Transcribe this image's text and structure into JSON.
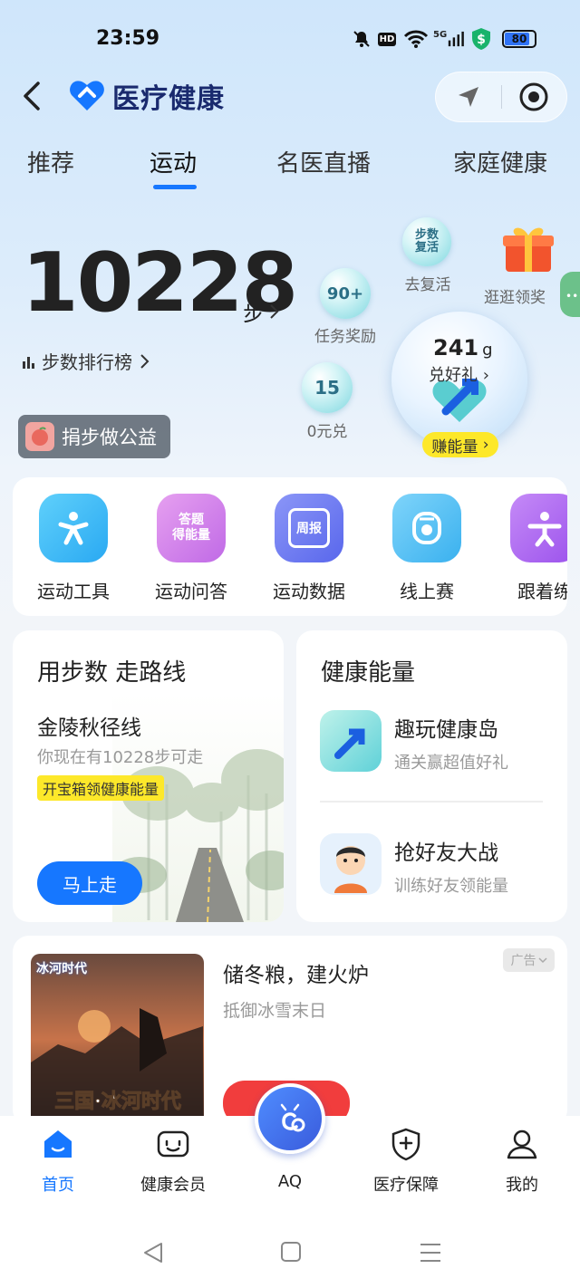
{
  "status_bar": {
    "time": "23:59",
    "hd_label": "HD",
    "network_label": "5G",
    "battery": "80"
  },
  "header": {
    "logo_text": "医疗健康",
    "icons": [
      "back-arrow-icon",
      "location-arrow-icon",
      "target-record-icon"
    ]
  },
  "tabs": [
    {
      "label": "推荐",
      "active": false
    },
    {
      "label": "运动",
      "active": true
    },
    {
      "label": "名医直播",
      "active": false
    },
    {
      "label": "家庭健康",
      "active": false
    }
  ],
  "steps": {
    "count": "10228",
    "unit": "步",
    "rank_label": "步数排行榜",
    "donate_label": "捐步做公益"
  },
  "bubbles": {
    "revive": {
      "text": "步数\n复活",
      "label": "去复活"
    },
    "gift": {
      "label": "逛逛领奖"
    },
    "task": {
      "value": "90+",
      "label": "任务奖励"
    },
    "redeem": {
      "value": "15",
      "label": "0元兑"
    }
  },
  "energy_orb": {
    "value": "241",
    "unit": "g",
    "sub": "兑好礼",
    "earn_label": "赚能量"
  },
  "tools": [
    {
      "label": "运动工具",
      "icon_text": "",
      "color": "#35b8f5"
    },
    {
      "label": "运动问答",
      "icon_text": "答题\n得能量",
      "color": "#d67ee8"
    },
    {
      "label": "运动数据",
      "icon_text": "周报",
      "color": "#6c7cf2"
    },
    {
      "label": "线上赛",
      "icon_text": "",
      "color": "#49c0f2"
    },
    {
      "label": "跟着练",
      "icon_text": "",
      "color": "#b06cf0"
    }
  ],
  "route_card": {
    "title": "用步数 走路线",
    "route_name": "金陵秋径线",
    "desc": "你现在有10228步可走",
    "badge": "开宝箱领健康能量",
    "button": "马上走"
  },
  "energy_card": {
    "title": "健康能量",
    "rows": [
      {
        "title": "趣玩健康岛",
        "sub": "通关赢超值好礼"
      },
      {
        "title": "抢好友大战",
        "sub": "训练好友领能量"
      }
    ]
  },
  "ad": {
    "title": "储冬粮，建火炉",
    "sub": "抵御冰雪末日",
    "tag": "广告",
    "image_title": "冰河时代",
    "image_caption": "三国·冰河时代"
  },
  "bottom_nav": [
    {
      "label": "首页",
      "active": true
    },
    {
      "label": "健康会员",
      "active": false
    },
    {
      "label": "AQ",
      "active": false
    },
    {
      "label": "医疗保障",
      "active": false
    },
    {
      "label": "我的",
      "active": false
    }
  ],
  "colors": {
    "accent": "#1677ff",
    "badge_yellow": "#fde82a",
    "ad_cta": "#f13d3d"
  }
}
